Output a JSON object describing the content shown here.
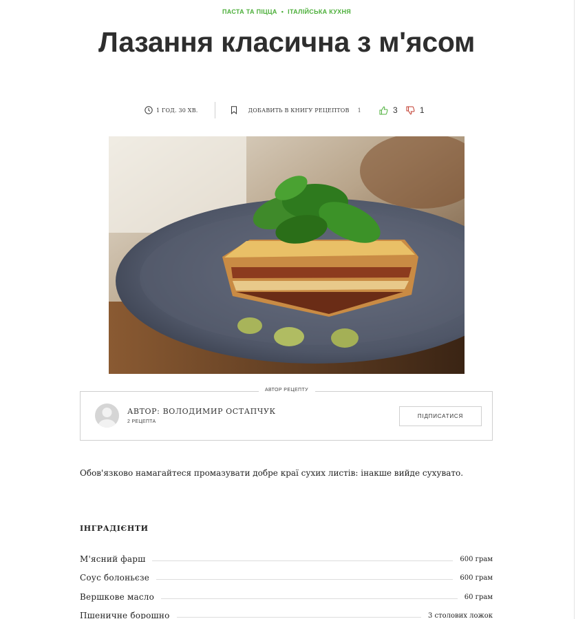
{
  "categories": [
    "ПАСТА ТА ПІЦЦА",
    "ІТАЛІЙСЬКА КУХНЯ"
  ],
  "category_separator": "•",
  "title": "Лазання класична з м'ясом",
  "meta": {
    "time": "1 ГОД. 30 ХВ.",
    "add_to_book": "ДОБАВИТЬ В КНИГУ РЕЦЕПТОВ",
    "bookmark_count": "1",
    "likes": "3",
    "dislikes": "1"
  },
  "photo": {
    "icon": "lasagna-photo"
  },
  "author": {
    "section_label": "АВТОР РЕЦЕПТУ",
    "name": "АВТОР: ВОЛОДИМИР ОСТАПЧУК",
    "recipes_count": "2 РЕЦЕПТА",
    "subscribe_label": "ПІДПИСАТИСЯ"
  },
  "description": "Обов'язково намагайтеся промазувати добре краї сухих листів: інакше вийде сухувато.",
  "ingredients": {
    "title": "ІНГРАДІЄНТИ",
    "items": [
      {
        "name": "М'ясний фарш",
        "qty": "600 грам"
      },
      {
        "name": "Соус болоньєзе",
        "qty": "600 грам"
      },
      {
        "name": "Вершкове масло",
        "qty": "60 грам"
      },
      {
        "name": "Пшеничне борошно",
        "qty": "3 столових ложок"
      }
    ]
  },
  "colors": {
    "accent": "#4caf3a",
    "dislike": "#c0392b",
    "text": "#2e2e2e"
  }
}
